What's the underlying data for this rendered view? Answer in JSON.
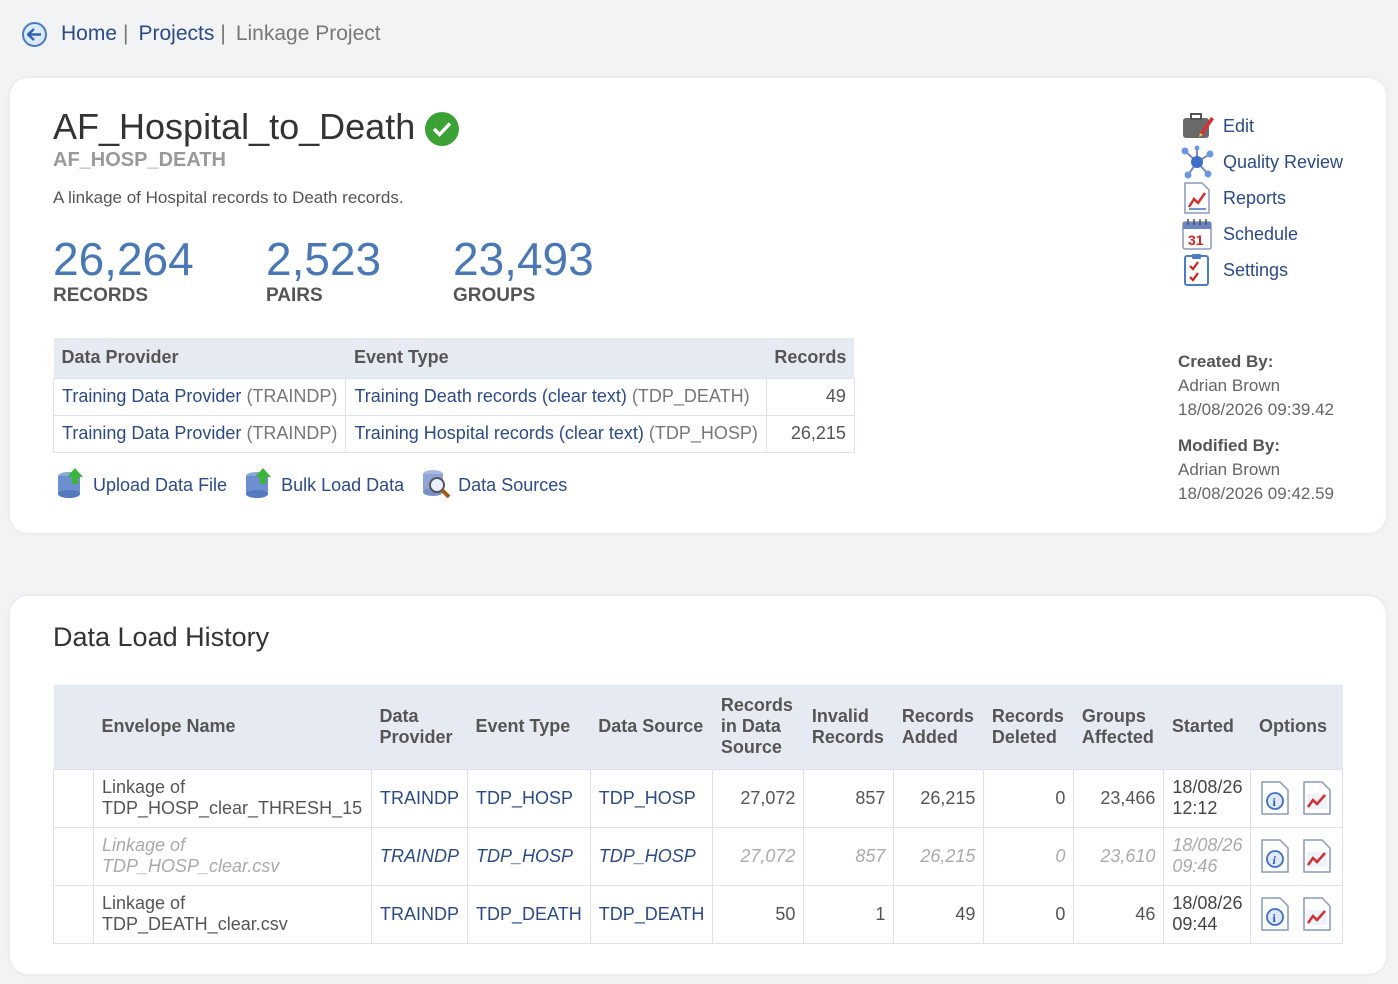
{
  "breadcrumb": {
    "home": "Home",
    "projects": "Projects",
    "current": "Linkage Project",
    "sep": "|"
  },
  "project": {
    "title": "AF_Hospital_to_Death",
    "code": "AF_HOSP_DEATH",
    "description": "A linkage of Hospital records to Death records."
  },
  "stats": [
    {
      "value": "26,264",
      "label": "RECORDS"
    },
    {
      "value": "2,523",
      "label": "PAIRS"
    },
    {
      "value": "23,493",
      "label": "GROUPS"
    }
  ],
  "providers": {
    "headers": [
      "Data Provider",
      "Event Type",
      "Records"
    ],
    "rows": [
      {
        "provider": "Training Data Provider",
        "provider_code": "(TRAINDP)",
        "event": "Training Death records (clear text)",
        "event_code": "(TDP_DEATH)",
        "records": "49"
      },
      {
        "provider": "Training Data Provider",
        "provider_code": "(TRAINDP)",
        "event": "Training Hospital records (clear text)",
        "event_code": "(TDP_HOSP)",
        "records": "26,215"
      }
    ]
  },
  "actions": {
    "upload": "Upload Data File",
    "bulk": "Bulk Load Data",
    "sources": "Data Sources"
  },
  "menu": {
    "edit": "Edit",
    "quality": "Quality Review",
    "reports": "Reports",
    "schedule": "Schedule",
    "settings": "Settings"
  },
  "meta": {
    "created_label": "Created By:",
    "created_by": "Adrian Brown",
    "created_at": "18/08/2026 09:39.42",
    "modified_label": "Modified By:",
    "modified_by": "Adrian Brown",
    "modified_at": "18/08/2026 09:42.59"
  },
  "history": {
    "title": "Data Load History",
    "headers": [
      "Envelope Name",
      "Data Provider",
      "Event Type",
      "Data Source",
      "Records in Data Source",
      "Invalid Records",
      "Records Added",
      "Records Deleted",
      "Groups Affected",
      "Started",
      "Options"
    ],
    "rows": [
      {
        "name1": "Linkage of",
        "name2": "TDP_HOSP_clear_THRESH_15",
        "provider": "TRAINDP",
        "event": "TDP_HOSP",
        "source": "TDP_HOSP",
        "in_source": "27,072",
        "invalid": "857",
        "added": "26,215",
        "deleted": "0",
        "groups": "23,466",
        "date": "18/08/26",
        "time": "12:12"
      },
      {
        "name1": "Linkage of",
        "name2": "TDP_HOSP_clear.csv",
        "provider": "TRAINDP",
        "event": "TDP_HOSP",
        "source": "TDP_HOSP",
        "in_source": "27,072",
        "invalid": "857",
        "added": "26,215",
        "deleted": "0",
        "groups": "23,610",
        "date": "18/08/26",
        "time": "09:46"
      },
      {
        "name1": "Linkage of",
        "name2": "TDP_DEATH_clear.csv",
        "provider": "TRAINDP",
        "event": "TDP_DEATH",
        "source": "TDP_DEATH",
        "in_source": "50",
        "invalid": "1",
        "added": "49",
        "deleted": "0",
        "groups": "46",
        "date": "18/08/26",
        "time": "09:44"
      }
    ]
  },
  "colors": {
    "link": "#2a4a8a",
    "stat": "#4a78b5",
    "header_bg": "#e6ebf3",
    "ok": "#3ba336"
  }
}
